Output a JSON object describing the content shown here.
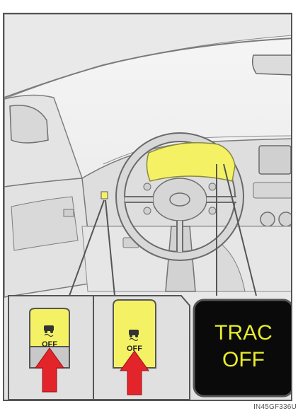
{
  "illustration": {
    "subject": "steering-wheel-dashboard",
    "code": "IN45GF336U"
  },
  "insets": {
    "switch_label": "OFF",
    "switch_icon": "vehicle-skid-icon",
    "indicator_line1": "TRAC",
    "indicator_line2": "OFF"
  },
  "colors": {
    "highlight": "#f4f264",
    "indicator_text": "#e8ec2c",
    "indicator_bg": "#0a0a0a",
    "arrow": "#e3242b",
    "line": "#555555"
  }
}
